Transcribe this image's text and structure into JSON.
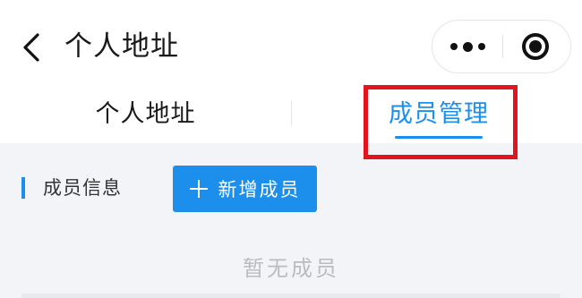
{
  "header": {
    "back_icon": "chevron-left-icon",
    "title": "个人地址",
    "capsule": {
      "more_icon": "more-dots-icon",
      "close_icon": "target-close-icon"
    }
  },
  "tabs": [
    {
      "label": "个人地址",
      "active": false
    },
    {
      "label": "成员管理",
      "active": true
    }
  ],
  "section": {
    "title": "成员信息",
    "add_button": {
      "icon": "plus-icon",
      "label": "新增成员"
    }
  },
  "empty_state": "暂无成员",
  "colors": {
    "accent": "#1a8ff0",
    "highlight": "#e2151f",
    "background": "#f3f4f8",
    "text": "#1a1a1a",
    "placeholder": "#bcbcbc"
  }
}
